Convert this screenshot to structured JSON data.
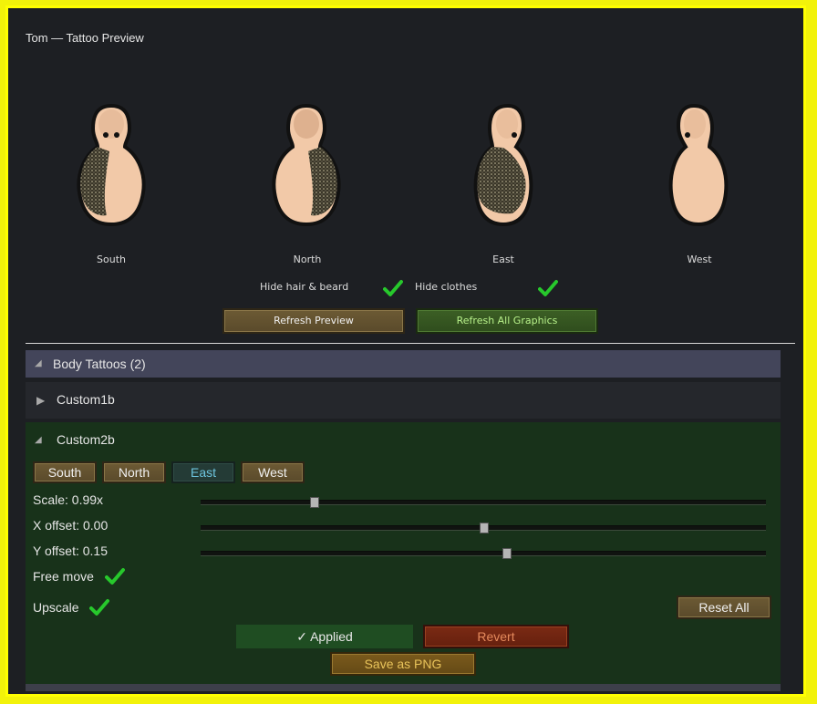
{
  "window": {
    "title": "Tom  —  Tattoo Preview"
  },
  "preview": {
    "directions": [
      "South",
      "North",
      "East",
      "West"
    ],
    "hide_hair_label": "Hide hair & beard",
    "hide_hair_checked": true,
    "hide_clothes_label": "Hide clothes",
    "hide_clothes_checked": true,
    "refresh_preview_label": "Refresh Preview",
    "refresh_all_label": "Refresh All Graphics"
  },
  "body_tattoos": {
    "header": "Body Tattoos (2)",
    "items": [
      {
        "name": "Custom1b",
        "expanded": false
      },
      {
        "name": "Custom2b",
        "expanded": true
      }
    ]
  },
  "editor": {
    "dir_buttons": [
      "South",
      "North",
      "East",
      "West"
    ],
    "active_dir": "East",
    "scale_label": "Scale: 0.99x",
    "scale_value": 0.2,
    "xoff_label": "X offset: 0.00",
    "xoff_value": 0.5,
    "yoff_label": "Y offset: 0.15",
    "yoff_value": 0.54,
    "free_move_label": "Free move",
    "free_move_checked": true,
    "upscale_label": "Upscale",
    "upscale_checked": true,
    "reset_all_label": "Reset All",
    "applied_label": "✓  Applied",
    "revert_label": "Revert",
    "save_png_label": "Save as PNG"
  },
  "colors": {
    "frame": "#ffff00",
    "panel_bg": "#1d1f23",
    "expanded_bg": "#18321a",
    "check": "#27c82c"
  }
}
